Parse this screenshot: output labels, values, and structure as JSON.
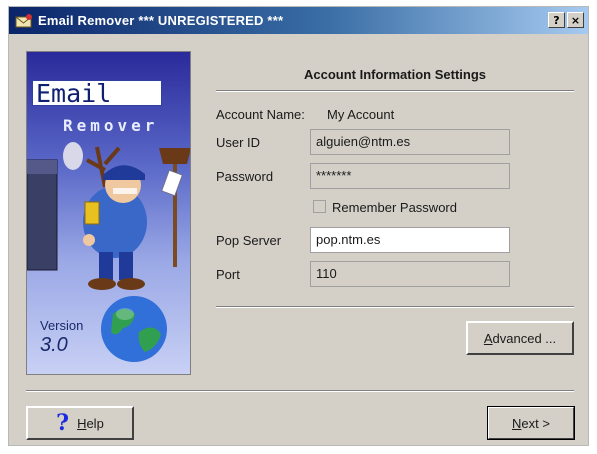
{
  "window": {
    "title": "Email Remover *** UNREGISTERED ***",
    "help_glyph": "?",
    "close_glyph": "×"
  },
  "sidebar": {
    "logo_line1": "Email",
    "logo_line2": "Remover",
    "version_label": "Version",
    "version_number": "3.0"
  },
  "main": {
    "section_title": "Account Information Settings",
    "account_name_label": "Account Name:",
    "account_name_value": "My Account",
    "user_id_label": "User ID",
    "user_id_value": "alguien@ntm.es",
    "password_label": "Password",
    "password_value": "*******",
    "remember_label": "Remember Password",
    "remember_checked": false,
    "pop_server_label": "Pop Server",
    "pop_server_value": "pop.ntm.es",
    "port_label": "Port",
    "port_value": "110",
    "advanced_button": "Advanced ..."
  },
  "footer": {
    "help_icon_glyph": "?",
    "help_button": "Help",
    "next_button": "Next >"
  },
  "colors": {
    "titlebar_start": "#0a246a",
    "dialog_bg": "#d4d0c8",
    "help_icon": "#1a2ae0"
  },
  "icons": {
    "app": "envelope-icon",
    "help": "question-mark-icon",
    "close": "close-icon"
  }
}
